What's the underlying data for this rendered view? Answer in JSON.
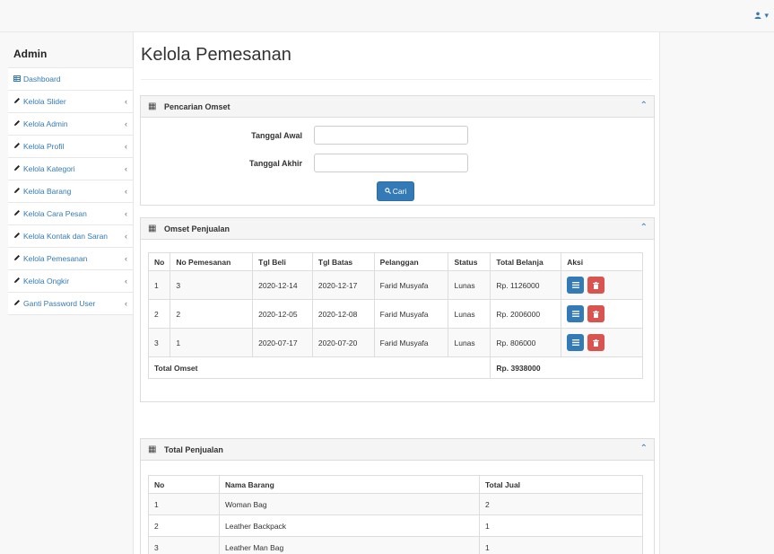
{
  "topbar": {
    "user_icon": "user-icon",
    "caret": "▾"
  },
  "sidebar": {
    "brand": "Admin",
    "items": [
      {
        "label": "Dashboard",
        "icon": "table-icon",
        "chevron": false
      },
      {
        "label": "Kelola Slider",
        "icon": "pencil-icon",
        "chevron": true
      },
      {
        "label": "Kelola Admin",
        "icon": "pencil-icon",
        "chevron": true
      },
      {
        "label": "Kelola Profil",
        "icon": "pencil-icon",
        "chevron": true
      },
      {
        "label": "Kelola Kategori",
        "icon": "pencil-icon",
        "chevron": true
      },
      {
        "label": "Kelola Barang",
        "icon": "pencil-icon",
        "chevron": true
      },
      {
        "label": "Kelola Cara Pesan",
        "icon": "pencil-icon",
        "chevron": true
      },
      {
        "label": "Kelola Kontak dan Saran",
        "icon": "pencil-icon",
        "chevron": true
      },
      {
        "label": "Kelola Pemesanan",
        "icon": "pencil-icon",
        "chevron": true
      },
      {
        "label": "Kelola Ongkir",
        "icon": "pencil-icon",
        "chevron": true
      },
      {
        "label": "Ganti Password User",
        "icon": "pencil-icon",
        "chevron": true
      }
    ]
  },
  "main": {
    "title": "Kelola Pemesanan",
    "search_panel": {
      "title": "Pencarian Omset",
      "start_label": "Tanggal Awal",
      "start_value": "",
      "end_label": "Tanggal Akhir",
      "end_value": "",
      "button_label": "Cari"
    },
    "sales_panel": {
      "title": "Omset Penjualan",
      "headers": [
        "No",
        "No Pemesanan",
        "Tgl Beli",
        "Tgl Batas",
        "Pelanggan",
        "Status",
        "Total Belanja",
        "Aksi"
      ],
      "rows": [
        [
          "1",
          "3",
          "2020-12-14",
          "2020-12-17",
          "Farid Musyafa",
          "Lunas",
          "Rp. 1126000"
        ],
        [
          "2",
          "2",
          "2020-12-05",
          "2020-12-08",
          "Farid Musyafa",
          "Lunas",
          "Rp. 2006000"
        ],
        [
          "3",
          "1",
          "2020-07-17",
          "2020-07-20",
          "Farid Musyafa",
          "Lunas",
          "Rp. 806000"
        ]
      ],
      "total_label": "Total Omset",
      "total_value": "Rp. 3938000"
    },
    "total_panel": {
      "title": "Total Penjualan",
      "headers": [
        "No",
        "Nama Barang",
        "Total Jual"
      ],
      "rows": [
        [
          "1",
          "Woman Bag",
          "2"
        ],
        [
          "2",
          "Leather Backpack",
          "1"
        ],
        [
          "3",
          "Leather Man Bag",
          "1"
        ]
      ]
    }
  }
}
